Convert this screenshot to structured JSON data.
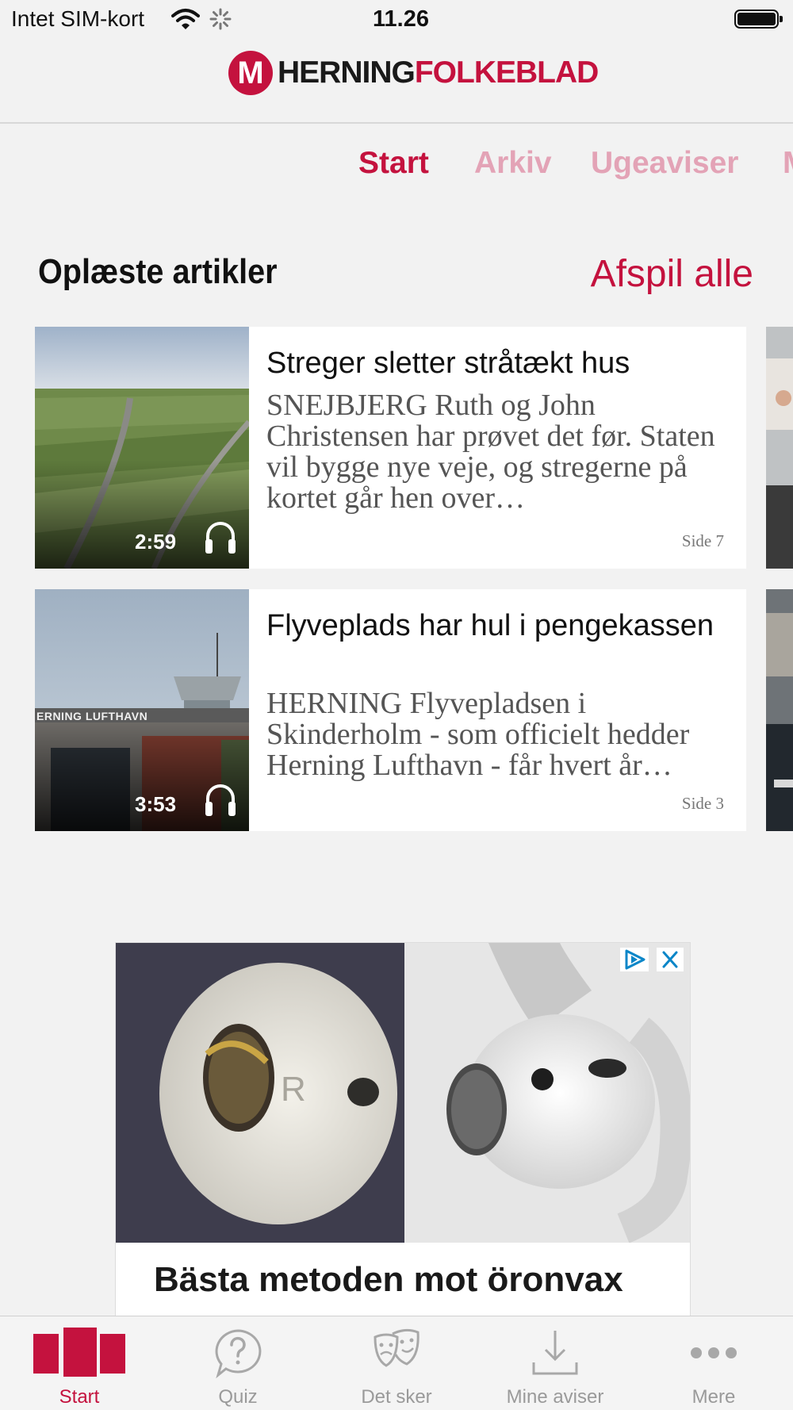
{
  "status_bar": {
    "carrier": "Intet SIM-kort",
    "time": "11.26"
  },
  "header": {
    "logo_part1": "HERNING",
    "logo_part2": "FOLKEBLAD",
    "logo_mark": "M"
  },
  "tabs": [
    {
      "label": "Start",
      "active": true
    },
    {
      "label": "Arkiv",
      "active": false
    },
    {
      "label": "Ugeaviser",
      "active": false
    },
    {
      "label": "M",
      "active": false
    }
  ],
  "section": {
    "title": "Oplæste artikler",
    "play_all": "Afspil alle"
  },
  "articles": [
    {
      "title": "Streger sletter stråtækt hus",
      "excerpt": "SNEJBJERG Ruth og John Christensen har prøvet det før. Staten vil bygge nye veje, og stregerne på kortet går hen over…",
      "page": "Side 7",
      "duration": "2:59",
      "thumb_icon": "aerial-landscape-photo"
    },
    {
      "title": "Flyveplads har hul i pengekassen",
      "excerpt": "HERNING Flyvepladsen i Skinderholm - som officielt hedder Herning Lufthavn - får hvert år…",
      "page": "Side 3",
      "duration": "3:53",
      "thumb_sign": "ERNING LUFTHAVN",
      "thumb_icon": "airport-tower-photo"
    }
  ],
  "ad": {
    "headline": "Bästa metoden mot öronvax",
    "image_letter": "R"
  },
  "tabbar": [
    {
      "label": "Start",
      "icon": "newspaper-icon",
      "active": true
    },
    {
      "label": "Quiz",
      "icon": "question-bubble-icon",
      "active": false
    },
    {
      "label": "Det sker",
      "icon": "theater-masks-icon",
      "active": false
    },
    {
      "label": "Mine aviser",
      "icon": "download-icon",
      "active": false
    },
    {
      "label": "Mere",
      "icon": "more-dots-icon",
      "active": false
    }
  ],
  "colors": {
    "accent": "#c4123e",
    "accent_light": "#e3a3b6",
    "background": "#f2f2f2"
  }
}
